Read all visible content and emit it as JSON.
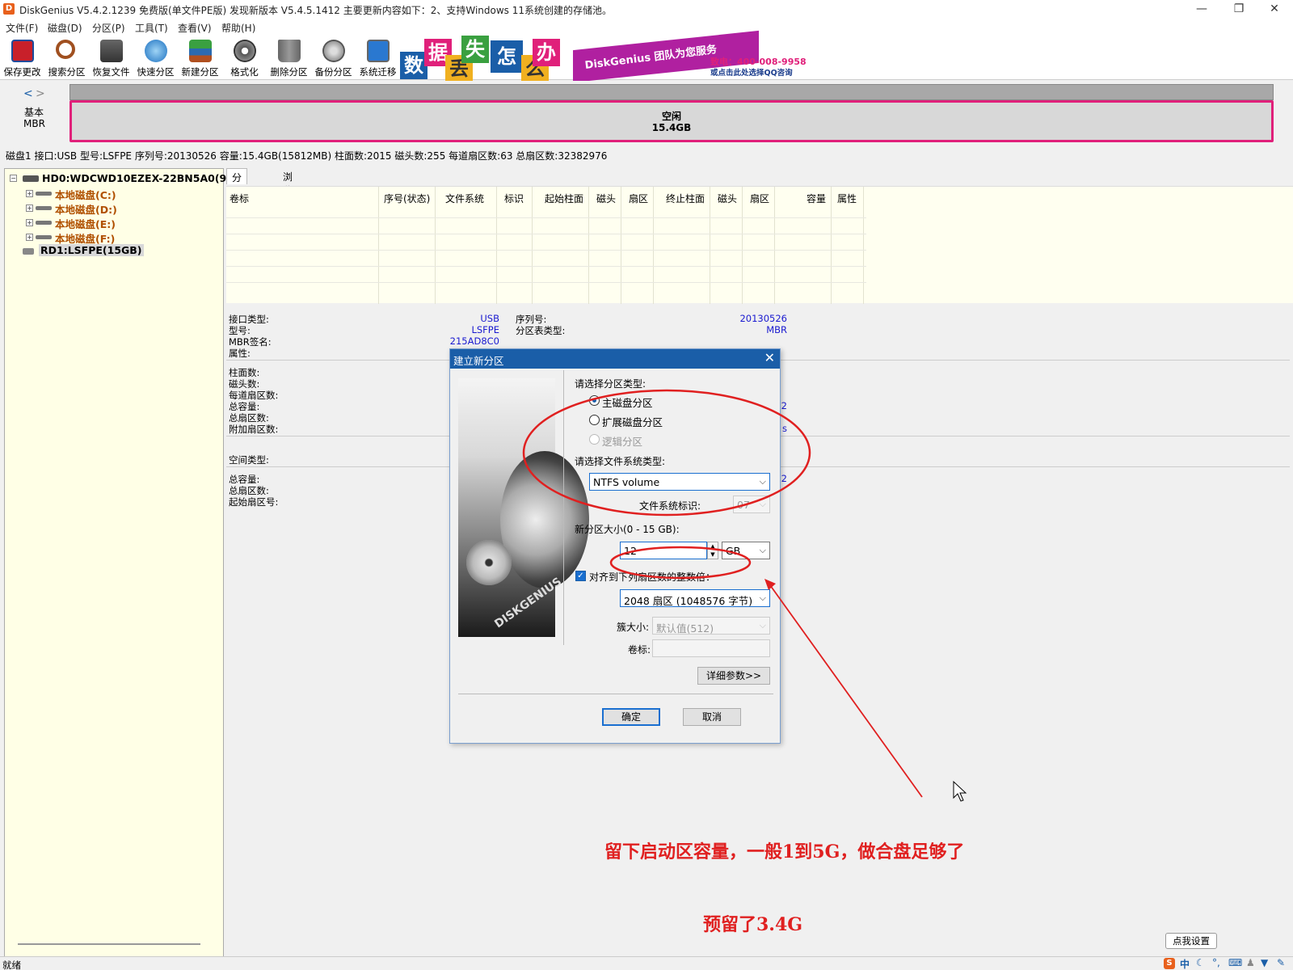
{
  "window": {
    "title": "DiskGenius V5.4.2.1239 免费版(单文件PE版)   发现新版本 V5.4.5.1412   主要更新内容如下：2、支持Windows 11系统创建的存储池。",
    "app_icon": "D"
  },
  "menu": [
    "文件(F)",
    "磁盘(D)",
    "分区(P)",
    "工具(T)",
    "查看(V)",
    "帮助(H)"
  ],
  "toolbar": [
    {
      "label": "保存更改",
      "icon": "save-icon"
    },
    {
      "label": "搜索分区",
      "icon": "search-icon"
    },
    {
      "label": "恢复文件",
      "icon": "recover-icon"
    },
    {
      "label": "快速分区",
      "icon": "quick-partition-icon"
    },
    {
      "label": "新建分区",
      "icon": "new-partition-icon"
    },
    {
      "label": "格式化",
      "icon": "format-icon"
    },
    {
      "label": "删除分区",
      "icon": "delete-icon"
    },
    {
      "label": "备份分区",
      "icon": "backup-icon"
    },
    {
      "label": "系统迁移",
      "icon": "migrate-icon"
    }
  ],
  "banner": {
    "chars": [
      "数",
      "据",
      "丢",
      "失",
      "怎",
      "么",
      "办"
    ],
    "slogan": "DiskGenius 团队为您服务",
    "phone": "致电：400-008-9958",
    "qq": "或点击此处选择QQ咨询"
  },
  "diskmap": {
    "nav_left": "<",
    "nav_right": ">",
    "disk_type": "基本",
    "table_type": "MBR",
    "free_label": "空闲",
    "free_size": "15.4GB"
  },
  "disk_info": "磁盘1 接口:USB  型号:LSFPE  序列号:20130526  容量:15.4GB(15812MB)  柱面数:2015  磁头数:255  每道扇区数:63  总扇区数:32382976",
  "tree": {
    "hd0": "HD0:WDCWD10EZEX-22BN5A0(93",
    "partitions": [
      "本地磁盘(C:)",
      "本地磁盘(D:)",
      "本地磁盘(E:)",
      "本地磁盘(F:)"
    ],
    "rd1": "RD1:LSFPE(15GB)"
  },
  "tabs": [
    "分区参数",
    "浏览文件"
  ],
  "table_headers": [
    "卷标",
    "序号(状态)",
    "文件系统",
    "标识",
    "起始柱面",
    "磁头",
    "扇区",
    "终止柱面",
    "磁头",
    "扇区",
    "容量",
    "属性"
  ],
  "props": {
    "interface_label": "接口类型:",
    "interface_value": "USB",
    "serial_label": "序列号:",
    "serial_value": "20130526",
    "model_label": "型号:",
    "model_value": "LSFPE",
    "pt_label": "分区表类型:",
    "pt_value": "MBR",
    "mbr_sig_label": "MBR签名:",
    "mbr_sig_value": "215AD8C0",
    "attr_label": "属性:",
    "cyl_label": "柱面数:",
    "heads_label": "磁头数:",
    "spt_label": "每道扇区数:",
    "cap_label": "总容量:",
    "sectors_label": "总扇区数:",
    "extra_label": "附加扇区数:",
    "partial_value_1": "2",
    "partial_value_2": "s",
    "space_type_label": "空间类型:",
    "cap2_label": "总容量:",
    "sectors2_label": "总扇区数:",
    "start_label": "起始扇区号:",
    "partial_value_3": "2"
  },
  "dialog": {
    "title": "建立新分区",
    "close": "✕",
    "image_text": "DISKGENIUS",
    "type_prompt": "请选择分区类型:",
    "primary": "主磁盘分区",
    "extended": "扩展磁盘分区",
    "logical": "逻辑分区",
    "fs_prompt": "请选择文件系统类型:",
    "fs_value": "NTFS volume",
    "fs_id_label": "文件系统标识:",
    "fs_id_value": "07",
    "size_prompt": "新分区大小(0 - 15 GB):",
    "size_value": "12",
    "size_unit": "GB",
    "align_label": "对齐到下列扇区数的整数倍：",
    "align_value": "2048 扇区 (1048576 字节)",
    "cluster_label": "簇大小:",
    "cluster_value": "默认值(512)",
    "volume_label": "卷标:",
    "volume_value": "",
    "advanced_btn": "详细参数>>",
    "ok_btn": "确定",
    "cancel_btn": "取消"
  },
  "annotations": {
    "line1": "留下启动区容量，一般1到5G，做合盘足够了",
    "line2": "预留了3.4G"
  },
  "status": {
    "left": "就绪",
    "tip": "点我设置",
    "ime": "中"
  },
  "colors": {
    "accent": "#1a5ea8",
    "free_border": "#e0207a",
    "annotation": "#e02020",
    "value_blue": "#1a1ad0",
    "partition_brown": "#b05000"
  }
}
